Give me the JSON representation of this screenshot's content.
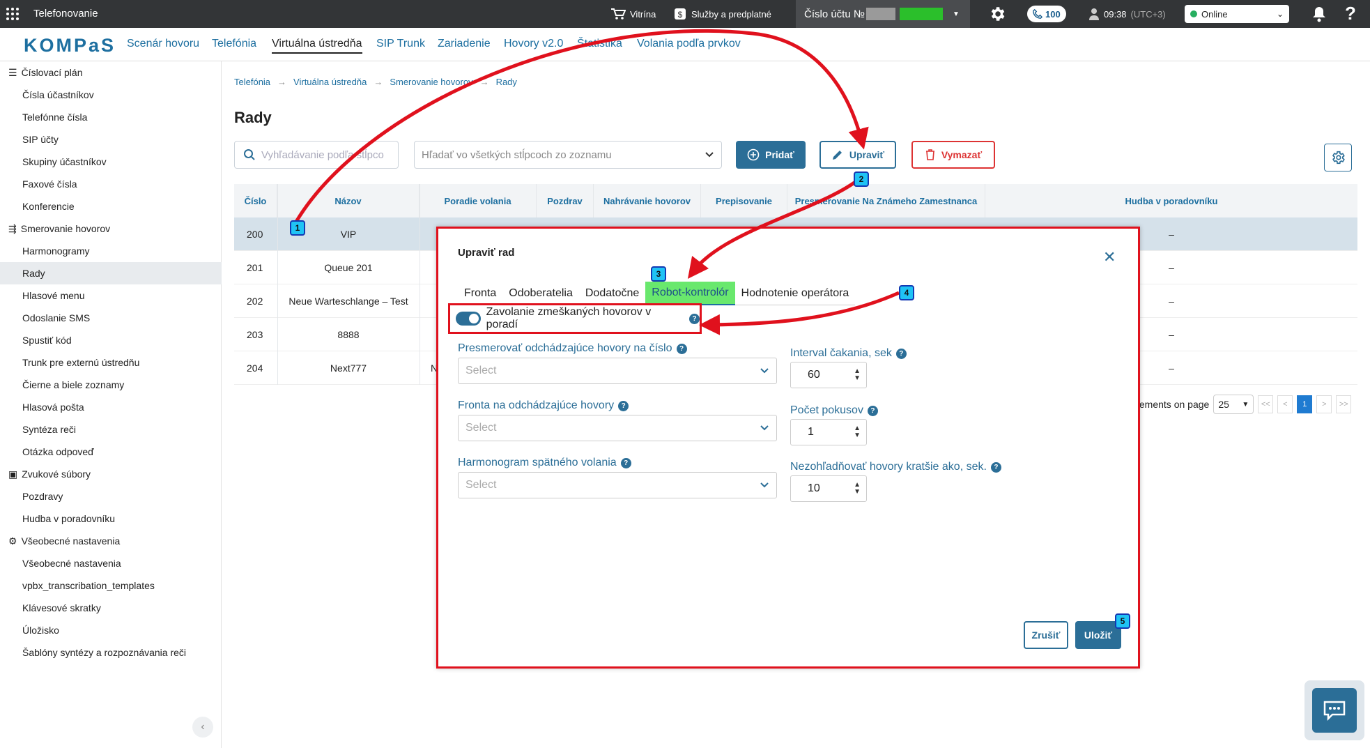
{
  "topbar": {
    "app_name": "Telefonovanie",
    "shop_label": "Vitrína",
    "services_label": "Služby a predplatné",
    "account_label": "Číslo účtu №",
    "calls_count": "100",
    "time": "09:38",
    "timezone": "(UTC+3)",
    "status": "Online",
    "help": "?"
  },
  "nav": {
    "logo": "KOMPaS",
    "links": [
      "Scenár hovoru",
      "Telefónia",
      "Virtuálna ústredňa",
      "SIP Trunk",
      "Zariadenie",
      "Hovory v2.0",
      "Štatistika",
      "Volania podľa prvkov"
    ]
  },
  "sidebar": {
    "sections": [
      {
        "title": "Číslovací plán",
        "items": [
          "Čísla účastníkov",
          "Telefónne čísla",
          "SIP účty",
          "Skupiny účastníkov",
          "Faxové čísla",
          "Konferencie"
        ]
      },
      {
        "title": "Smerovanie hovorov",
        "items": [
          "Harmonogramy",
          "Rady",
          "Hlasové menu",
          "Odoslanie SMS",
          "Spustiť kód",
          "Trunk pre externú ústredňu",
          "Čierne a biele zoznamy",
          "Hlasová pošta",
          "Syntéza reči",
          "Otázka odpoveď"
        ]
      },
      {
        "title": "Zvukové súbory",
        "items": [
          "Pozdravy",
          "Hudba v poradovníku"
        ]
      },
      {
        "title": "Všeobecné nastavenia",
        "items": [
          "Všeobecné nastavenia",
          "vpbx_transcribation_templates",
          "Klávesové skratky",
          "Úložisko",
          "Šablóny syntézy a rozpoznávania reči"
        ]
      }
    ]
  },
  "breadcrumbs": [
    "Telefónia",
    "Virtuálna ústredňa",
    "Smerovanie hovorov",
    "Rady"
  ],
  "page_title": "Rady",
  "toolbar": {
    "search_placeholder": "Vyhľadávanie podľa stĺpco",
    "column_search_placeholder": "Hľadať vo všetkých stĺpcoch zo zoznamu",
    "add_label": "Pridať",
    "edit_label": "Upraviť",
    "delete_label": "Vymazať"
  },
  "table": {
    "columns": [
      "Číslo",
      "Názov",
      "Poradie volania",
      "Pozdrav",
      "Nahrávanie hovorov",
      "Prepisovanie",
      "Presmerovanie Na Známeho Zamestnanca",
      "Hudba v poradovníku"
    ],
    "rows": [
      {
        "num": "200",
        "name": "VIP",
        "music": "–"
      },
      {
        "num": "201",
        "name": "Queue 201",
        "music": "–"
      },
      {
        "num": "202",
        "name": "Neue Warteschlange – Test",
        "music": "–"
      },
      {
        "num": "203",
        "name": "8888",
        "music": "–"
      },
      {
        "num": "204",
        "name": "Next777",
        "extra": "N",
        "music": "–"
      }
    ]
  },
  "pagination": {
    "label": "elements on page",
    "page_size": "25",
    "first": "<<",
    "prev": "<",
    "current": "1",
    "next": ">",
    "last": ">>"
  },
  "modal": {
    "title": "Upraviť rad",
    "tabs": [
      "Fronta",
      "Odoberatelia",
      "Dodatočne",
      "Robot-kontrolór",
      "Hodnotenie operátora"
    ],
    "toggle_label": "Zavolanie zmeškaných hovorov v poradí",
    "redirect_label": "Presmerovať odchádzajúce hovory na číslo",
    "redirect_value": "Select",
    "queue_label": "Fronta na odchádzajúce hovory",
    "queue_value": "Select",
    "schedule_label": "Harmonogram spätného volania",
    "schedule_value": "Select",
    "interval_label": "Interval čakania, sek",
    "interval_value": "60",
    "attempts_label": "Počet pokusov",
    "attempts_value": "1",
    "ignore_label": "Nezohľadňovať hovory kratšie ako, sek.",
    "ignore_value": "10",
    "cancel_label": "Zrušiť",
    "save_label": "Uložiť"
  },
  "badges": [
    "1",
    "2",
    "3",
    "4",
    "5"
  ],
  "colors": {
    "accent": "#2b6e97",
    "highlight_border": "#e0111d",
    "active_tab_bg": "#69e86d",
    "badge_bg": "#1fc3f5"
  }
}
